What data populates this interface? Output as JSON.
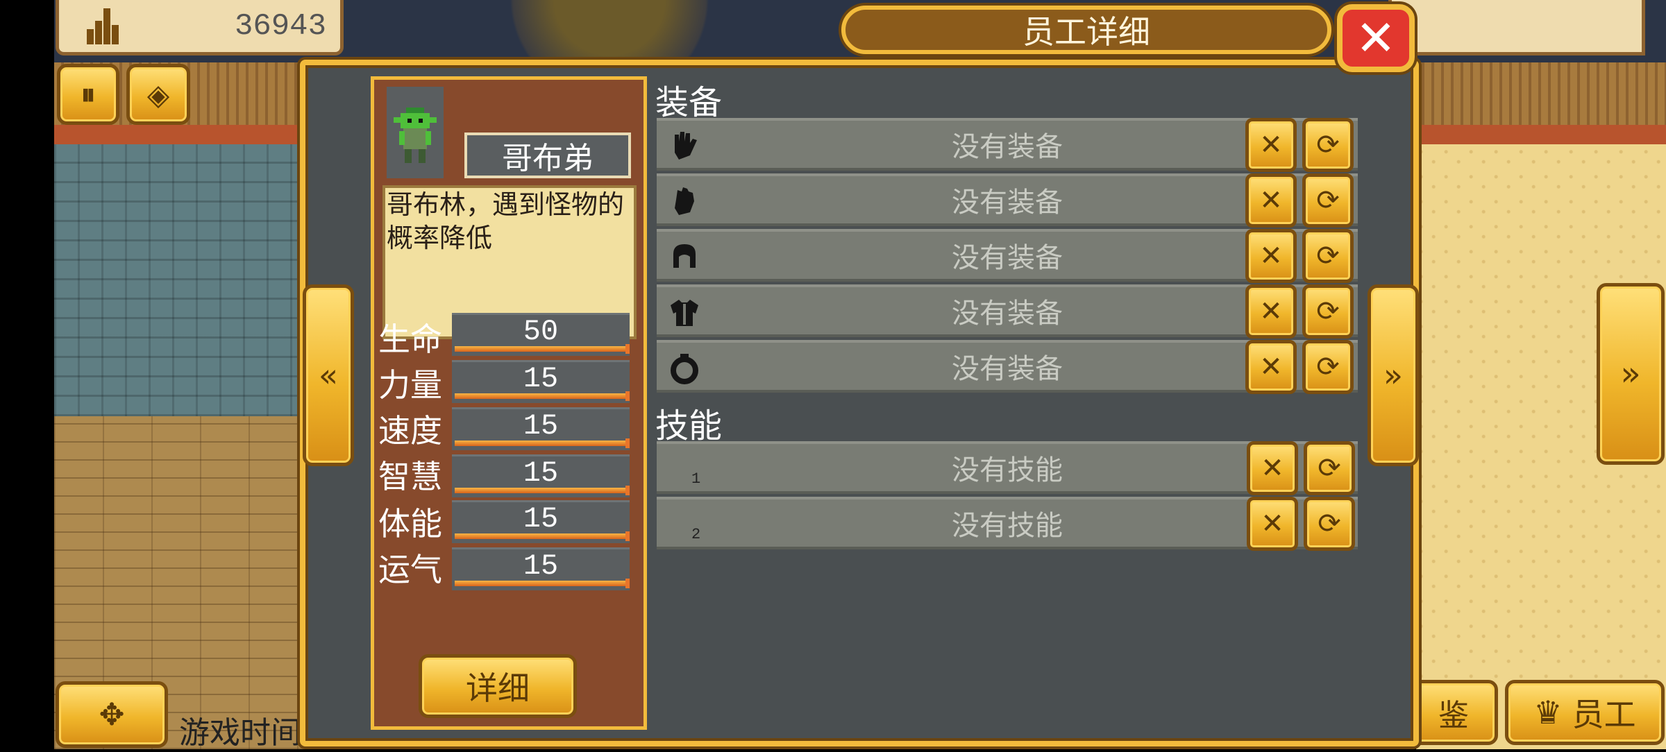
{
  "hud": {
    "money": "36943",
    "money_icon": "building-icon",
    "pause_icon": "pause-icon",
    "ore_icon": "ore-icon",
    "game_time_label": "游戏时间",
    "nav_icon": "move-arrows-icon",
    "right_button_partial_label": "鉴",
    "staff_button_label": "员工",
    "staff_icon": "crown-icon"
  },
  "dialog": {
    "title": "员工详细",
    "close_icon": "close-icon",
    "prev_icon": "double-left-arrow-icon",
    "next_icon": "double-right-arrow-icon"
  },
  "character": {
    "name": "哥布弟",
    "description": "哥布林，遇到怪物的概率降低",
    "stats": [
      {
        "label": "生命",
        "value": "50"
      },
      {
        "label": "力量",
        "value": "15"
      },
      {
        "label": "速度",
        "value": "15"
      },
      {
        "label": "智慧",
        "value": "15"
      },
      {
        "label": "体能",
        "value": "15"
      },
      {
        "label": "运气",
        "value": "15"
      }
    ],
    "stat_fill_fraction": 1.0,
    "detail_button": "详细"
  },
  "equipment": {
    "title": "装备",
    "slots": [
      {
        "icon": "glove-icon",
        "text": "没有装备"
      },
      {
        "icon": "gauntlet-icon",
        "text": "没有装备"
      },
      {
        "icon": "helmet-icon",
        "text": "没有装备"
      },
      {
        "icon": "armor-icon",
        "text": "没有装备"
      },
      {
        "icon": "ring-icon",
        "text": "没有装备"
      }
    ]
  },
  "skills": {
    "title": "技能",
    "slots": [
      {
        "number": "1",
        "text": "没有技能"
      },
      {
        "number": "2",
        "text": "没有技能"
      }
    ]
  },
  "colors": {
    "gold": "#f2bb3c",
    "panel": "#4a4f51",
    "card": "#874a2c",
    "close_red": "#e2372e"
  }
}
